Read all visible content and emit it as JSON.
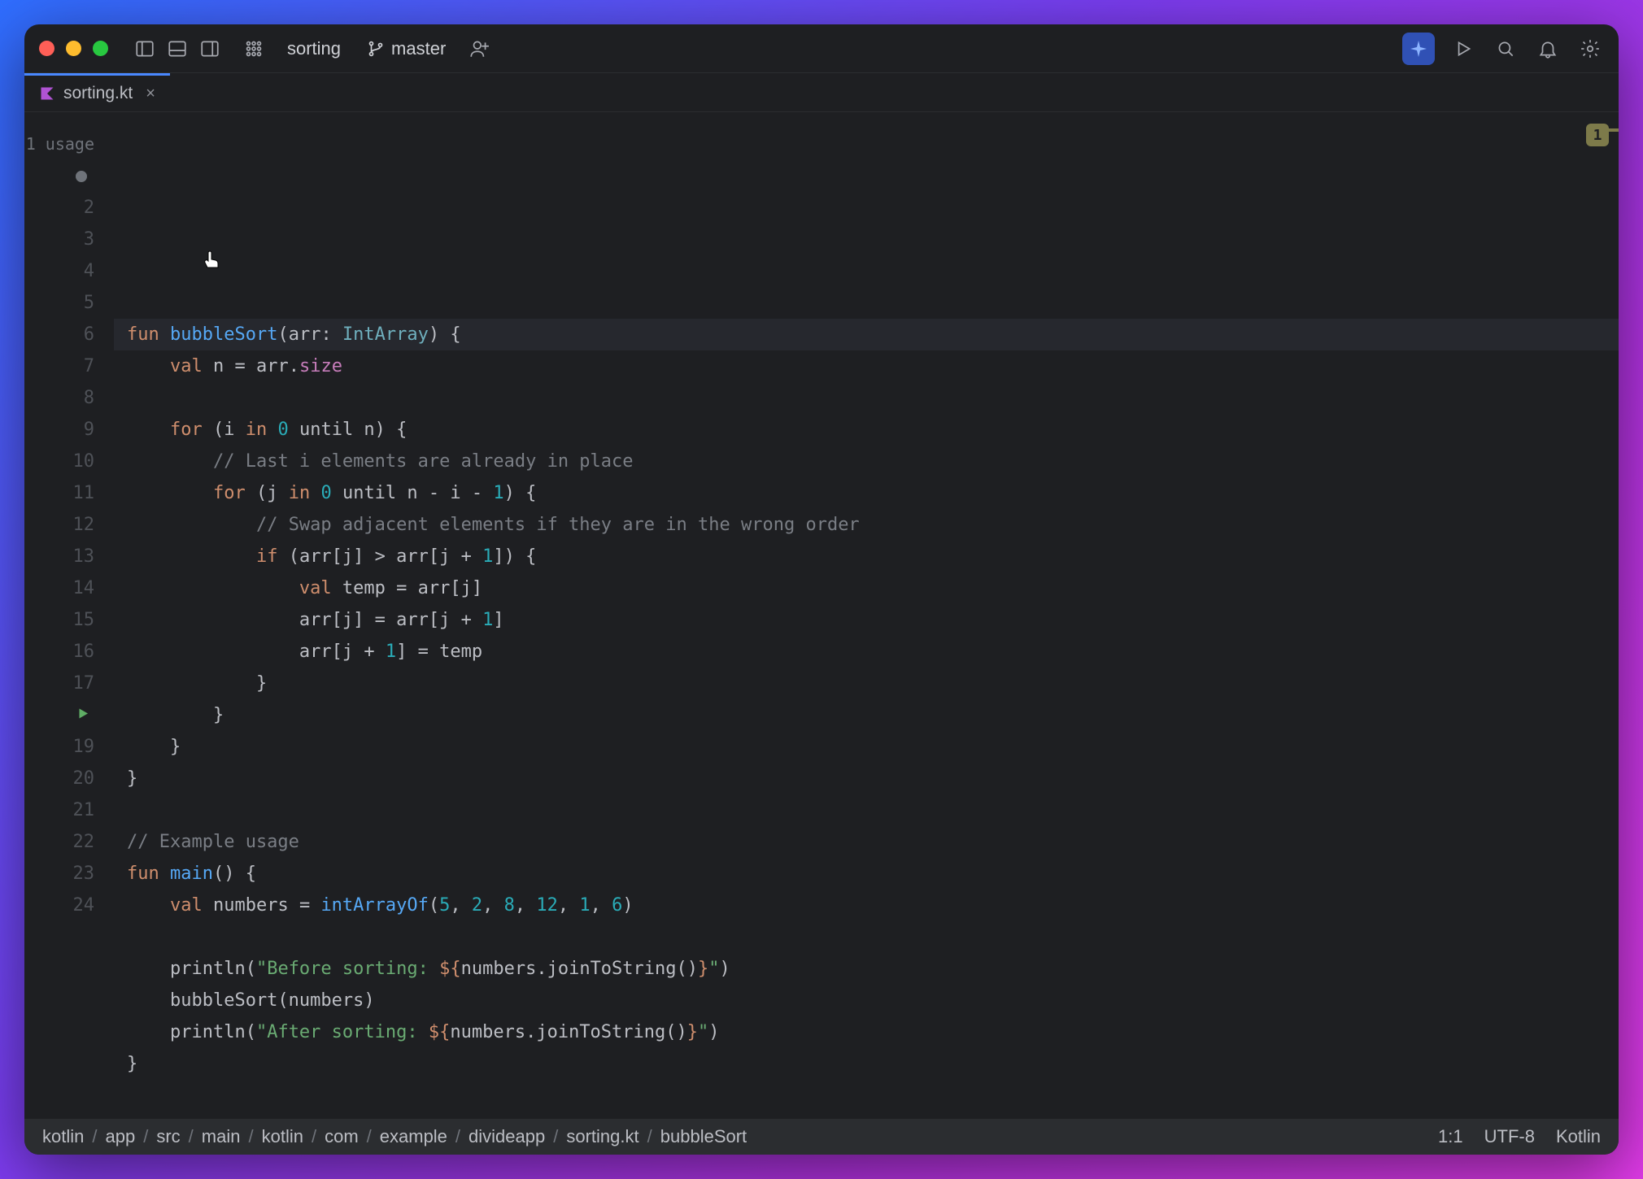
{
  "titlebar": {
    "project": "sorting",
    "branch": "master"
  },
  "tab": {
    "icon": "kotlin-file-icon",
    "label": "sorting.kt"
  },
  "usage_hint": "1 usage",
  "warning_badge": "1",
  "gutter": {
    "lines": [
      "",
      "2",
      "3",
      "4",
      "5",
      "6",
      "7",
      "8",
      "9",
      "10",
      "11",
      "12",
      "13",
      "14",
      "15",
      "16",
      "17",
      "",
      "19",
      "20",
      "21",
      "22",
      "23",
      "24"
    ]
  },
  "code": [
    {
      "hl": true,
      "tokens": [
        [
          "kw",
          "fun"
        ],
        [
          "id",
          " "
        ],
        [
          "fn",
          "bubbleSort"
        ],
        [
          "id",
          "("
        ],
        [
          "id",
          "arr: "
        ],
        [
          "type",
          "IntArray"
        ],
        [
          "id",
          ") {"
        ]
      ]
    },
    {
      "tokens": [
        [
          "id",
          "    "
        ],
        [
          "kw",
          "val"
        ],
        [
          "id",
          " n = arr."
        ],
        [
          "prop",
          "size"
        ]
      ]
    },
    {
      "tokens": [
        [
          "id",
          ""
        ]
      ]
    },
    {
      "tokens": [
        [
          "id",
          "    "
        ],
        [
          "kw",
          "for"
        ],
        [
          "id",
          " (i "
        ],
        [
          "kw",
          "in"
        ],
        [
          "id",
          " "
        ],
        [
          "num",
          "0"
        ],
        [
          "id",
          " until n) {"
        ]
      ]
    },
    {
      "tokens": [
        [
          "id",
          "        "
        ],
        [
          "cm",
          "// Last i elements are already in place"
        ]
      ]
    },
    {
      "tokens": [
        [
          "id",
          "        "
        ],
        [
          "kw",
          "for"
        ],
        [
          "id",
          " (j "
        ],
        [
          "kw",
          "in"
        ],
        [
          "id",
          " "
        ],
        [
          "num",
          "0"
        ],
        [
          "id",
          " until n - i - "
        ],
        [
          "num",
          "1"
        ],
        [
          "id",
          ") {"
        ]
      ]
    },
    {
      "tokens": [
        [
          "id",
          "            "
        ],
        [
          "cm",
          "// Swap adjacent elements if they are in the wrong order"
        ]
      ]
    },
    {
      "tokens": [
        [
          "id",
          "            "
        ],
        [
          "kw",
          "if"
        ],
        [
          "id",
          " (arr[j] > arr[j + "
        ],
        [
          "num",
          "1"
        ],
        [
          "id",
          "]) {"
        ]
      ]
    },
    {
      "tokens": [
        [
          "id",
          "                "
        ],
        [
          "kw",
          "val"
        ],
        [
          "id",
          " temp = arr[j]"
        ]
      ]
    },
    {
      "tokens": [
        [
          "id",
          "                arr[j] = arr[j + "
        ],
        [
          "num",
          "1"
        ],
        [
          "id",
          "]"
        ]
      ]
    },
    {
      "tokens": [
        [
          "id",
          "                arr[j + "
        ],
        [
          "num",
          "1"
        ],
        [
          "id",
          "] = temp"
        ]
      ]
    },
    {
      "tokens": [
        [
          "id",
          "            }"
        ]
      ]
    },
    {
      "tokens": [
        [
          "id",
          "        }"
        ]
      ]
    },
    {
      "tokens": [
        [
          "id",
          "    }"
        ]
      ]
    },
    {
      "tokens": [
        [
          "id",
          "}"
        ]
      ]
    },
    {
      "tokens": [
        [
          "id",
          ""
        ]
      ]
    },
    {
      "tokens": [
        [
          "cm",
          "// Example usage"
        ]
      ]
    },
    {
      "tokens": [
        [
          "kw",
          "fun"
        ],
        [
          "id",
          " "
        ],
        [
          "fn",
          "main"
        ],
        [
          "id",
          "() {"
        ]
      ]
    },
    {
      "tokens": [
        [
          "id",
          "    "
        ],
        [
          "kw",
          "val"
        ],
        [
          "id",
          " numbers = "
        ],
        [
          "fn",
          "intArrayOf"
        ],
        [
          "id",
          "("
        ],
        [
          "num",
          "5"
        ],
        [
          "id",
          ", "
        ],
        [
          "num",
          "2"
        ],
        [
          "id",
          ", "
        ],
        [
          "num",
          "8"
        ],
        [
          "id",
          ", "
        ],
        [
          "num",
          "12"
        ],
        [
          "id",
          ", "
        ],
        [
          "num",
          "1"
        ],
        [
          "id",
          ", "
        ],
        [
          "num",
          "6"
        ],
        [
          "id",
          ")"
        ]
      ]
    },
    {
      "tokens": [
        [
          "id",
          ""
        ]
      ]
    },
    {
      "tokens": [
        [
          "id",
          "    println("
        ],
        [
          "str",
          "\"Before sorting: "
        ],
        [
          "tpl",
          "${"
        ],
        [
          "id",
          "numbers.joinToString()"
        ],
        [
          "tpl",
          "}"
        ],
        [
          "str",
          "\""
        ],
        [
          "id",
          ")"
        ]
      ]
    },
    {
      "tokens": [
        [
          "id",
          "    bubbleSort(numbers)"
        ]
      ]
    },
    {
      "tokens": [
        [
          "id",
          "    println("
        ],
        [
          "str",
          "\"After sorting: "
        ],
        [
          "tpl",
          "${"
        ],
        [
          "id",
          "numbers.joinToString()"
        ],
        [
          "tpl",
          "}"
        ],
        [
          "str",
          "\""
        ],
        [
          "id",
          ")"
        ]
      ]
    },
    {
      "tokens": [
        [
          "id",
          "}"
        ]
      ]
    }
  ],
  "breadcrumb": [
    "kotlin",
    "app",
    "src",
    "main",
    "kotlin",
    "com",
    "example",
    "divideapp",
    "sorting.kt",
    "bubbleSort"
  ],
  "status": {
    "pos": "1:1",
    "encoding": "UTF-8",
    "lang": "Kotlin"
  }
}
